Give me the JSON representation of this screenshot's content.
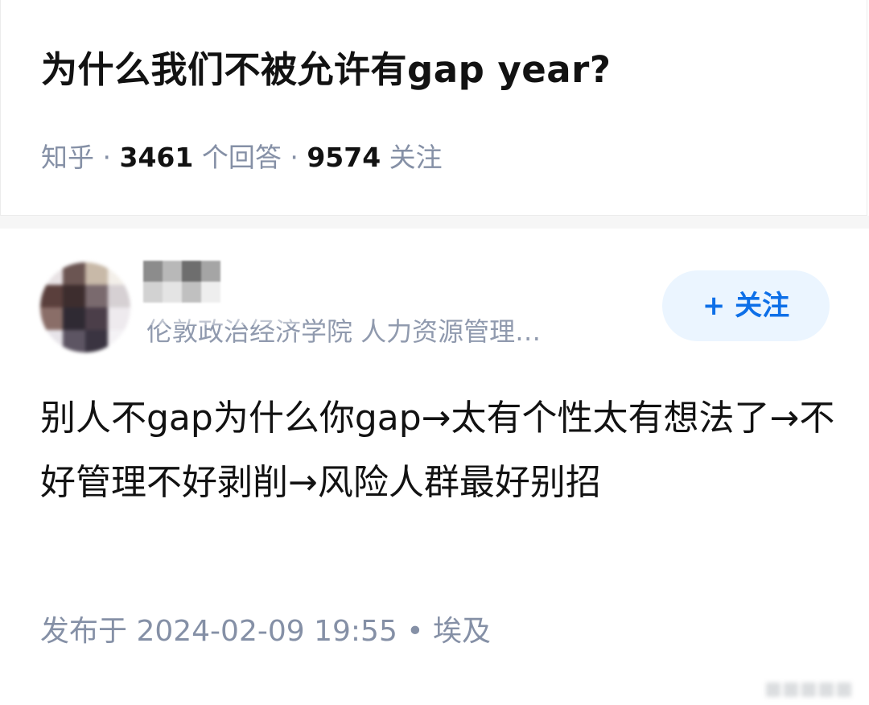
{
  "question": {
    "title": "为什么我们不被允许有gap year?",
    "source": "知乎",
    "sep1": " · ",
    "answers_count": "3461",
    "answers_label": " 个回答",
    "sep2": " · ",
    "followers_count": "9574",
    "followers_label": " 关注"
  },
  "author": {
    "description": "伦敦政治经济学院 人力资源管理…",
    "follow_label": "+ 关注",
    "avatar_colors": [
      "#e8e2e4",
      "#6b5552",
      "#c8b9a8",
      "#f3efe9",
      "#5a3f3c",
      "#3d2d2e",
      "#7a6a6e",
      "#d6d0d3",
      "#8a6e68",
      "#2f2a33",
      "#4b3e49",
      "#eeeaee",
      "#e7e4e9",
      "#5d5563",
      "#3a3441",
      "#f4f2f5"
    ],
    "name_colors": [
      "#8c8c8c",
      "#b8b8b8",
      "#6e6e6e",
      "#a5a5a5",
      "#d2d2d2",
      "#e4e4e4",
      "#c0c0c0",
      "#eeeeee"
    ]
  },
  "answer": {
    "content": "别人不gap为什么你gap→太有个性太有想法了→不好管理不好剥削→风险人群最好别招",
    "published": "发布于 2024-02-09 19:55 • 埃及"
  }
}
